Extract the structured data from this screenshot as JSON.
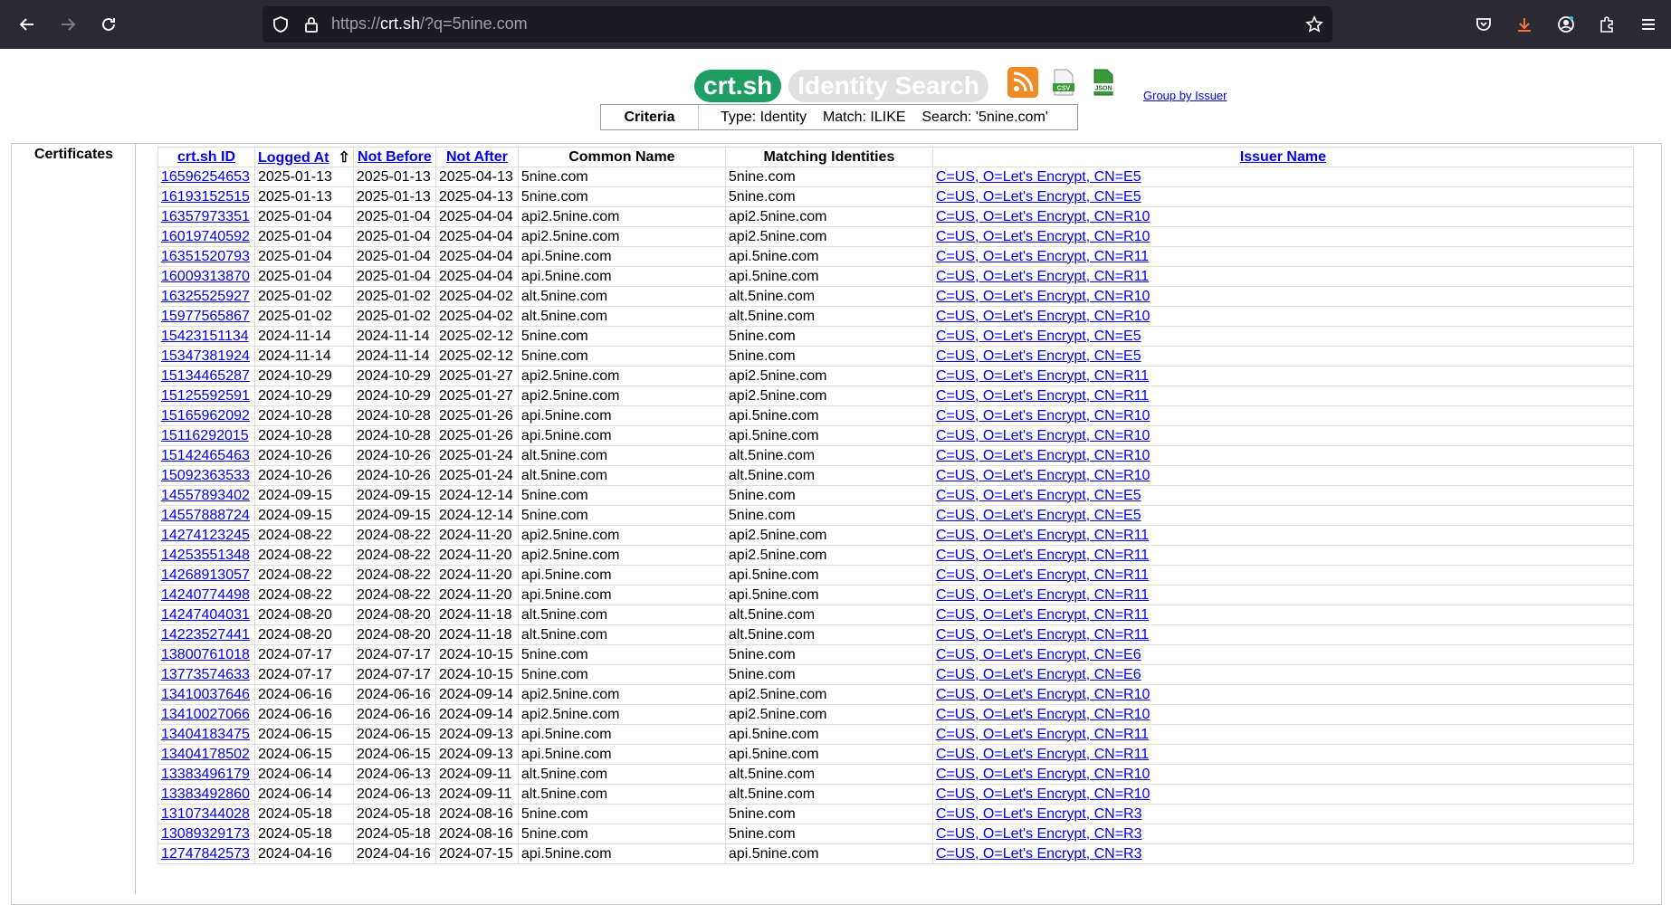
{
  "browser": {
    "url_prefix": "https://",
    "url_host": "crt.sh",
    "url_path": "/?q=5nine.com"
  },
  "header": {
    "logo_text": "crt.sh",
    "title_text": "Identity Search",
    "rss_label": "",
    "csv_label": "CSV",
    "json_label": "JSON",
    "group_link": "Group by Issuer"
  },
  "criteria": {
    "label": "Criteria",
    "value": "Type: Identity    Match: ILIKE    Search: '5nine.com'"
  },
  "certificates_label": "Certificates",
  "table": {
    "headers": {
      "id": "crt.sh ID",
      "logged_at": "Logged At",
      "sort_arrow": "⇧",
      "not_before": "Not Before",
      "not_after": "Not After",
      "common_name": "Common Name",
      "matching": "Matching Identities",
      "issuer": "Issuer Name"
    },
    "rows": [
      [
        "16596254653",
        "2025-01-13",
        "2025-01-13",
        "2025-04-13",
        "5nine.com",
        "5nine.com",
        "C=US, O=Let's Encrypt, CN=E5"
      ],
      [
        "16193152515",
        "2025-01-13",
        "2025-01-13",
        "2025-04-13",
        "5nine.com",
        "5nine.com",
        "C=US, O=Let's Encrypt, CN=E5"
      ],
      [
        "16357973351",
        "2025-01-04",
        "2025-01-04",
        "2025-04-04",
        "api2.5nine.com",
        "api2.5nine.com",
        "C=US, O=Let's Encrypt, CN=R10"
      ],
      [
        "16019740592",
        "2025-01-04",
        "2025-01-04",
        "2025-04-04",
        "api2.5nine.com",
        "api2.5nine.com",
        "C=US, O=Let's Encrypt, CN=R10"
      ],
      [
        "16351520793",
        "2025-01-04",
        "2025-01-04",
        "2025-04-04",
        "api.5nine.com",
        "api.5nine.com",
        "C=US, O=Let's Encrypt, CN=R11"
      ],
      [
        "16009313870",
        "2025-01-04",
        "2025-01-04",
        "2025-04-04",
        "api.5nine.com",
        "api.5nine.com",
        "C=US, O=Let's Encrypt, CN=R11"
      ],
      [
        "16325525927",
        "2025-01-02",
        "2025-01-02",
        "2025-04-02",
        "alt.5nine.com",
        "alt.5nine.com",
        "C=US, O=Let's Encrypt, CN=R10"
      ],
      [
        "15977565867",
        "2025-01-02",
        "2025-01-02",
        "2025-04-02",
        "alt.5nine.com",
        "alt.5nine.com",
        "C=US, O=Let's Encrypt, CN=R10"
      ],
      [
        "15423151134",
        "2024-11-14",
        "2024-11-14",
        "2025-02-12",
        "5nine.com",
        "5nine.com",
        "C=US, O=Let's Encrypt, CN=E5"
      ],
      [
        "15347381924",
        "2024-11-14",
        "2024-11-14",
        "2025-02-12",
        "5nine.com",
        "5nine.com",
        "C=US, O=Let's Encrypt, CN=E5"
      ],
      [
        "15134465287",
        "2024-10-29",
        "2024-10-29",
        "2025-01-27",
        "api2.5nine.com",
        "api2.5nine.com",
        "C=US, O=Let's Encrypt, CN=R11"
      ],
      [
        "15125592591",
        "2024-10-29",
        "2024-10-29",
        "2025-01-27",
        "api2.5nine.com",
        "api2.5nine.com",
        "C=US, O=Let's Encrypt, CN=R11"
      ],
      [
        "15165962092",
        "2024-10-28",
        "2024-10-28",
        "2025-01-26",
        "api.5nine.com",
        "api.5nine.com",
        "C=US, O=Let's Encrypt, CN=R10"
      ],
      [
        "15116292015",
        "2024-10-28",
        "2024-10-28",
        "2025-01-26",
        "api.5nine.com",
        "api.5nine.com",
        "C=US, O=Let's Encrypt, CN=R10"
      ],
      [
        "15142465463",
        "2024-10-26",
        "2024-10-26",
        "2025-01-24",
        "alt.5nine.com",
        "alt.5nine.com",
        "C=US, O=Let's Encrypt, CN=R10"
      ],
      [
        "15092363533",
        "2024-10-26",
        "2024-10-26",
        "2025-01-24",
        "alt.5nine.com",
        "alt.5nine.com",
        "C=US, O=Let's Encrypt, CN=R10"
      ],
      [
        "14557893402",
        "2024-09-15",
        "2024-09-15",
        "2024-12-14",
        "5nine.com",
        "5nine.com",
        "C=US, O=Let's Encrypt, CN=E5"
      ],
      [
        "14557888724",
        "2024-09-15",
        "2024-09-15",
        "2024-12-14",
        "5nine.com",
        "5nine.com",
        "C=US, O=Let's Encrypt, CN=E5"
      ],
      [
        "14274123245",
        "2024-08-22",
        "2024-08-22",
        "2024-11-20",
        "api2.5nine.com",
        "api2.5nine.com",
        "C=US, O=Let's Encrypt, CN=R11"
      ],
      [
        "14253551348",
        "2024-08-22",
        "2024-08-22",
        "2024-11-20",
        "api2.5nine.com",
        "api2.5nine.com",
        "C=US, O=Let's Encrypt, CN=R11"
      ],
      [
        "14268913057",
        "2024-08-22",
        "2024-08-22",
        "2024-11-20",
        "api.5nine.com",
        "api.5nine.com",
        "C=US, O=Let's Encrypt, CN=R11"
      ],
      [
        "14240774498",
        "2024-08-22",
        "2024-08-22",
        "2024-11-20",
        "api.5nine.com",
        "api.5nine.com",
        "C=US, O=Let's Encrypt, CN=R11"
      ],
      [
        "14247404031",
        "2024-08-20",
        "2024-08-20",
        "2024-11-18",
        "alt.5nine.com",
        "alt.5nine.com",
        "C=US, O=Let's Encrypt, CN=R11"
      ],
      [
        "14223527441",
        "2024-08-20",
        "2024-08-20",
        "2024-11-18",
        "alt.5nine.com",
        "alt.5nine.com",
        "C=US, O=Let's Encrypt, CN=R11"
      ],
      [
        "13800761018",
        "2024-07-17",
        "2024-07-17",
        "2024-10-15",
        "5nine.com",
        "5nine.com",
        "C=US, O=Let's Encrypt, CN=E6"
      ],
      [
        "13773574633",
        "2024-07-17",
        "2024-07-17",
        "2024-10-15",
        "5nine.com",
        "5nine.com",
        "C=US, O=Let's Encrypt, CN=E6"
      ],
      [
        "13410037646",
        "2024-06-16",
        "2024-06-16",
        "2024-09-14",
        "api2.5nine.com",
        "api2.5nine.com",
        "C=US, O=Let's Encrypt, CN=R10"
      ],
      [
        "13410027066",
        "2024-06-16",
        "2024-06-16",
        "2024-09-14",
        "api2.5nine.com",
        "api2.5nine.com",
        "C=US, O=Let's Encrypt, CN=R10"
      ],
      [
        "13404183475",
        "2024-06-15",
        "2024-06-15",
        "2024-09-13",
        "api.5nine.com",
        "api.5nine.com",
        "C=US, O=Let's Encrypt, CN=R11"
      ],
      [
        "13404178502",
        "2024-06-15",
        "2024-06-15",
        "2024-09-13",
        "api.5nine.com",
        "api.5nine.com",
        "C=US, O=Let's Encrypt, CN=R11"
      ],
      [
        "13383496179",
        "2024-06-14",
        "2024-06-13",
        "2024-09-11",
        "alt.5nine.com",
        "alt.5nine.com",
        "C=US, O=Let's Encrypt, CN=R10"
      ],
      [
        "13383492860",
        "2024-06-14",
        "2024-06-13",
        "2024-09-11",
        "alt.5nine.com",
        "alt.5nine.com",
        "C=US, O=Let's Encrypt, CN=R10"
      ],
      [
        "13107344028",
        "2024-05-18",
        "2024-05-18",
        "2024-08-16",
        "5nine.com",
        "5nine.com",
        "C=US, O=Let's Encrypt, CN=R3"
      ],
      [
        "13089329173",
        "2024-05-18",
        "2024-05-18",
        "2024-08-16",
        "5nine.com",
        "5nine.com",
        "C=US, O=Let's Encrypt, CN=R3"
      ],
      [
        "12747842573",
        "2024-04-16",
        "2024-04-16",
        "2024-07-15",
        "api.5nine.com",
        "api.5nine.com",
        "C=US, O=Let's Encrypt, CN=R3"
      ]
    ]
  },
  "colors": {
    "logo_bg": "#1e9e63",
    "title_bg": "#e0e0e0",
    "link": "#0000ee",
    "chrome_bg": "#2b2a33"
  }
}
